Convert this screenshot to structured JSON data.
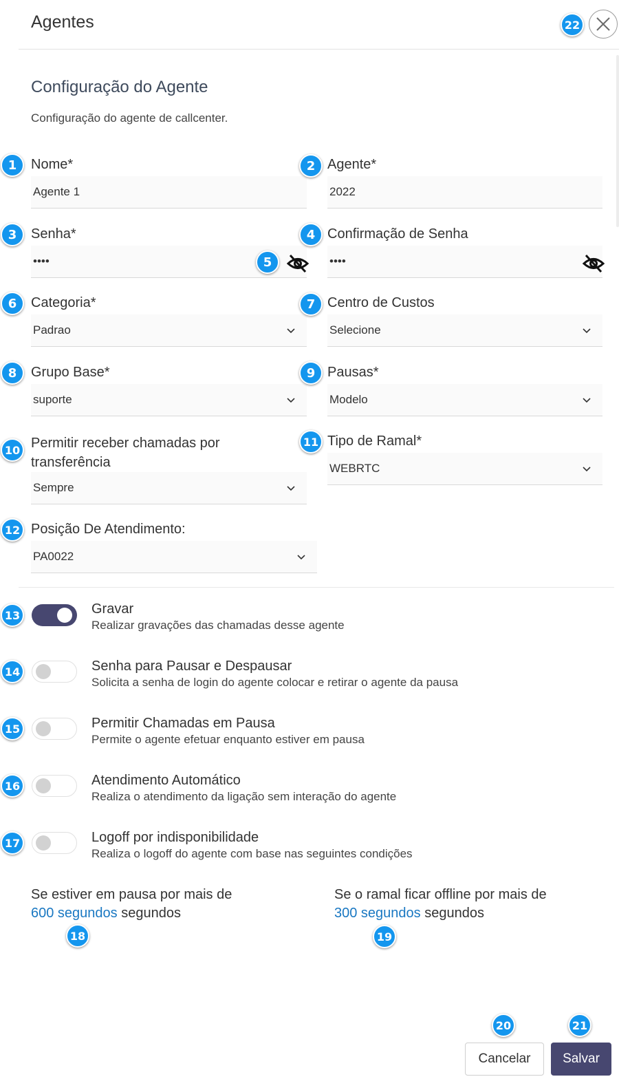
{
  "header": {
    "title": "Agentes"
  },
  "section": {
    "title": "Configuração do Agente",
    "subtitle": "Configuração do agente de callcenter."
  },
  "fields": {
    "nome": {
      "label": "Nome*",
      "value": "Agente 1"
    },
    "agente": {
      "label": "Agente*",
      "value": "2022"
    },
    "senha": {
      "label": "Senha*",
      "value": "••••"
    },
    "confirmacao": {
      "label": "Confirmação de Senha",
      "value": "••••"
    },
    "categoria": {
      "label": "Categoria*",
      "value": "Padrao"
    },
    "centro_custos": {
      "label": "Centro de Custos",
      "value": "Selecione"
    },
    "grupo_base": {
      "label": "Grupo Base*",
      "value": "suporte"
    },
    "pausas": {
      "label": "Pausas*",
      "value": "Modelo"
    },
    "transferencia": {
      "label_line1": "Permitir receber chamadas por",
      "label_line2": "transferência",
      "value": "Sempre"
    },
    "tipo_ramal": {
      "label": "Tipo de Ramal*",
      "value": "WEBRTC"
    },
    "posicao": {
      "label": "Posição De Atendimento:",
      "value": "PA0022"
    }
  },
  "switches": [
    {
      "title": "Gravar",
      "desc": "Realizar gravações das chamadas desse agente",
      "on": true
    },
    {
      "title": "Senha para Pausar e Despausar",
      "desc": "Solicita a senha de login do agente colocar e retirar o agente da pausa",
      "on": false
    },
    {
      "title": "Permitir Chamadas em Pausa",
      "desc": "Permite o agente efetuar enquanto estiver em pausa",
      "on": false
    },
    {
      "title": "Atendimento Automático",
      "desc": "Realiza o atendimento da ligação sem interação do agente",
      "on": false
    },
    {
      "title": "Logoff por indisponibilidade",
      "desc": "Realiza o logoff do agente com base nas seguintes condições",
      "on": false
    }
  ],
  "conditions": {
    "pausa": {
      "text": "Se estiver em pausa por mais de",
      "link": "600 segundos",
      "suffix": " segundos"
    },
    "offline": {
      "text": "Se o ramal ficar offline por mais de",
      "link": "300 segundos",
      "suffix": " segundos"
    }
  },
  "buttons": {
    "cancel": "Cancelar",
    "save": "Salvar"
  },
  "badges": [
    "1",
    "2",
    "3",
    "4",
    "5",
    "6",
    "7",
    "8",
    "9",
    "10",
    "11",
    "12",
    "13",
    "14",
    "15",
    "16",
    "17",
    "18",
    "19",
    "20",
    "21",
    "22"
  ],
  "colors": {
    "primary": "#474770",
    "badge": "#1496ee",
    "link": "#1a78c2"
  },
  "icons": {
    "close": "close-icon",
    "eye": "eye-off-icon",
    "chevron": "chevron-down-icon"
  }
}
